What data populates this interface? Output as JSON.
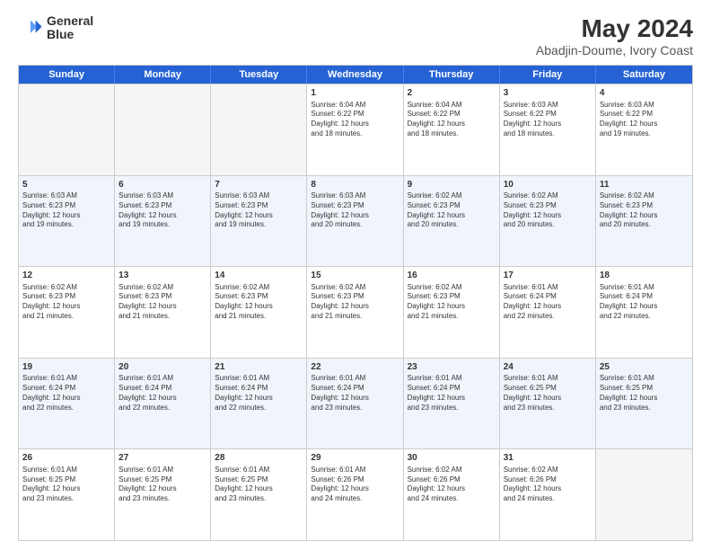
{
  "logo": {
    "general": "General",
    "blue": "Blue"
  },
  "title": "May 2024",
  "subtitle": "Abadjin-Doume, Ivory Coast",
  "header_days": [
    "Sunday",
    "Monday",
    "Tuesday",
    "Wednesday",
    "Thursday",
    "Friday",
    "Saturday"
  ],
  "rows": [
    {
      "alt": false,
      "cells": [
        {
          "day": "",
          "content": "",
          "empty": true
        },
        {
          "day": "",
          "content": "",
          "empty": true
        },
        {
          "day": "",
          "content": "",
          "empty": true
        },
        {
          "day": "1",
          "content": "Sunrise: 6:04 AM\nSunset: 6:22 PM\nDaylight: 12 hours\nand 18 minutes.",
          "empty": false
        },
        {
          "day": "2",
          "content": "Sunrise: 6:04 AM\nSunset: 6:22 PM\nDaylight: 12 hours\nand 18 minutes.",
          "empty": false
        },
        {
          "day": "3",
          "content": "Sunrise: 6:03 AM\nSunset: 6:22 PM\nDaylight: 12 hours\nand 18 minutes.",
          "empty": false
        },
        {
          "day": "4",
          "content": "Sunrise: 6:03 AM\nSunset: 6:22 PM\nDaylight: 12 hours\nand 19 minutes.",
          "empty": false
        }
      ]
    },
    {
      "alt": true,
      "cells": [
        {
          "day": "5",
          "content": "Sunrise: 6:03 AM\nSunset: 6:23 PM\nDaylight: 12 hours\nand 19 minutes.",
          "empty": false
        },
        {
          "day": "6",
          "content": "Sunrise: 6:03 AM\nSunset: 6:23 PM\nDaylight: 12 hours\nand 19 minutes.",
          "empty": false
        },
        {
          "day": "7",
          "content": "Sunrise: 6:03 AM\nSunset: 6:23 PM\nDaylight: 12 hours\nand 19 minutes.",
          "empty": false
        },
        {
          "day": "8",
          "content": "Sunrise: 6:03 AM\nSunset: 6:23 PM\nDaylight: 12 hours\nand 20 minutes.",
          "empty": false
        },
        {
          "day": "9",
          "content": "Sunrise: 6:02 AM\nSunset: 6:23 PM\nDaylight: 12 hours\nand 20 minutes.",
          "empty": false
        },
        {
          "day": "10",
          "content": "Sunrise: 6:02 AM\nSunset: 6:23 PM\nDaylight: 12 hours\nand 20 minutes.",
          "empty": false
        },
        {
          "day": "11",
          "content": "Sunrise: 6:02 AM\nSunset: 6:23 PM\nDaylight: 12 hours\nand 20 minutes.",
          "empty": false
        }
      ]
    },
    {
      "alt": false,
      "cells": [
        {
          "day": "12",
          "content": "Sunrise: 6:02 AM\nSunset: 6:23 PM\nDaylight: 12 hours\nand 21 minutes.",
          "empty": false
        },
        {
          "day": "13",
          "content": "Sunrise: 6:02 AM\nSunset: 6:23 PM\nDaylight: 12 hours\nand 21 minutes.",
          "empty": false
        },
        {
          "day": "14",
          "content": "Sunrise: 6:02 AM\nSunset: 6:23 PM\nDaylight: 12 hours\nand 21 minutes.",
          "empty": false
        },
        {
          "day": "15",
          "content": "Sunrise: 6:02 AM\nSunset: 6:23 PM\nDaylight: 12 hours\nand 21 minutes.",
          "empty": false
        },
        {
          "day": "16",
          "content": "Sunrise: 6:02 AM\nSunset: 6:23 PM\nDaylight: 12 hours\nand 21 minutes.",
          "empty": false
        },
        {
          "day": "17",
          "content": "Sunrise: 6:01 AM\nSunset: 6:24 PM\nDaylight: 12 hours\nand 22 minutes.",
          "empty": false
        },
        {
          "day": "18",
          "content": "Sunrise: 6:01 AM\nSunset: 6:24 PM\nDaylight: 12 hours\nand 22 minutes.",
          "empty": false
        }
      ]
    },
    {
      "alt": true,
      "cells": [
        {
          "day": "19",
          "content": "Sunrise: 6:01 AM\nSunset: 6:24 PM\nDaylight: 12 hours\nand 22 minutes.",
          "empty": false
        },
        {
          "day": "20",
          "content": "Sunrise: 6:01 AM\nSunset: 6:24 PM\nDaylight: 12 hours\nand 22 minutes.",
          "empty": false
        },
        {
          "day": "21",
          "content": "Sunrise: 6:01 AM\nSunset: 6:24 PM\nDaylight: 12 hours\nand 22 minutes.",
          "empty": false
        },
        {
          "day": "22",
          "content": "Sunrise: 6:01 AM\nSunset: 6:24 PM\nDaylight: 12 hours\nand 23 minutes.",
          "empty": false
        },
        {
          "day": "23",
          "content": "Sunrise: 6:01 AM\nSunset: 6:24 PM\nDaylight: 12 hours\nand 23 minutes.",
          "empty": false
        },
        {
          "day": "24",
          "content": "Sunrise: 6:01 AM\nSunset: 6:25 PM\nDaylight: 12 hours\nand 23 minutes.",
          "empty": false
        },
        {
          "day": "25",
          "content": "Sunrise: 6:01 AM\nSunset: 6:25 PM\nDaylight: 12 hours\nand 23 minutes.",
          "empty": false
        }
      ]
    },
    {
      "alt": false,
      "cells": [
        {
          "day": "26",
          "content": "Sunrise: 6:01 AM\nSunset: 6:25 PM\nDaylight: 12 hours\nand 23 minutes.",
          "empty": false
        },
        {
          "day": "27",
          "content": "Sunrise: 6:01 AM\nSunset: 6:25 PM\nDaylight: 12 hours\nand 23 minutes.",
          "empty": false
        },
        {
          "day": "28",
          "content": "Sunrise: 6:01 AM\nSunset: 6:25 PM\nDaylight: 12 hours\nand 23 minutes.",
          "empty": false
        },
        {
          "day": "29",
          "content": "Sunrise: 6:01 AM\nSunset: 6:26 PM\nDaylight: 12 hours\nand 24 minutes.",
          "empty": false
        },
        {
          "day": "30",
          "content": "Sunrise: 6:02 AM\nSunset: 6:26 PM\nDaylight: 12 hours\nand 24 minutes.",
          "empty": false
        },
        {
          "day": "31",
          "content": "Sunrise: 6:02 AM\nSunset: 6:26 PM\nDaylight: 12 hours\nand 24 minutes.",
          "empty": false
        },
        {
          "day": "",
          "content": "",
          "empty": true
        }
      ]
    }
  ]
}
